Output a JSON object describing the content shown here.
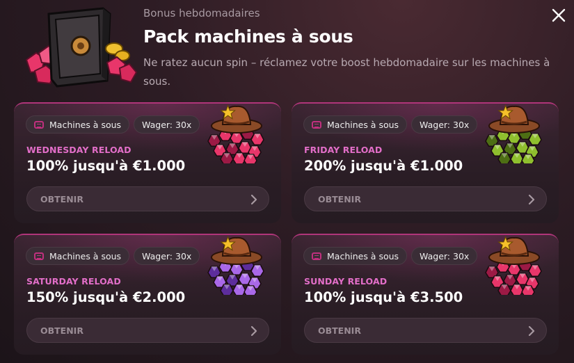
{
  "header": {
    "kicker": "Bonus hebdomadaires",
    "title": "Pack machines à sous",
    "description": "Ne ratez aucun spin – réclamez votre boost hebdomadaire sur les machines à sous."
  },
  "close_icon": "close-icon",
  "cards": [
    {
      "tag_category": "Machines à sous",
      "tag_wager": "Wager: 30x",
      "reload": "WEDNESDAY RELOAD",
      "amount": "100% jusqu'à €1.000",
      "cta": "OBTENIR",
      "gem_color": "#e8366a",
      "gem_dark": "#9c1a45"
    },
    {
      "tag_category": "Machines à sous",
      "tag_wager": "Wager: 30x",
      "reload": "FRIDAY RELOAD",
      "amount": "200% jusqu'à €1.000",
      "cta": "OBTENIR",
      "gem_color": "#8fbf2e",
      "gem_dark": "#4d6e14"
    },
    {
      "tag_category": "Machines à sous",
      "tag_wager": "Wager: 30x",
      "reload": "SATURDAY RELOAD",
      "amount": "150% jusqu'à €2.000",
      "cta": "OBTENIR",
      "gem_color": "#a968e8",
      "gem_dark": "#5d2d9c"
    },
    {
      "tag_category": "Machines à sous",
      "tag_wager": "Wager: 30x",
      "reload": "SUNDAY RELOAD",
      "amount": "100% jusqu'à €3.500",
      "cta": "OBTENIR",
      "gem_color": "#e8366a",
      "gem_dark": "#9c1a45"
    }
  ],
  "colors": {
    "accent": "#e26ec8",
    "border": "#b0357a",
    "background": "#2d1c24"
  }
}
